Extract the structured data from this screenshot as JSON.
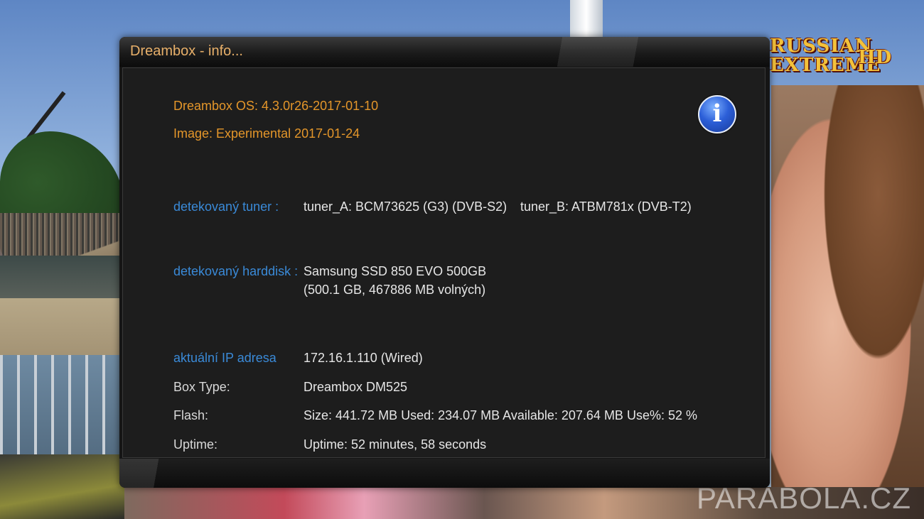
{
  "channel_logo": {
    "line1": "RUSSIAN",
    "line2": "EXTREME",
    "suffix": "HD"
  },
  "watermark": "PARABOLA.CZ",
  "dialog": {
    "title": "Dreambox - info...",
    "os_line": "Dreambox OS: 4.3.0r26-2017-01-10",
    "image_line": "Image: Experimental 2017-01-24",
    "info_icon_glyph": "i",
    "tuner": {
      "label": "detekovaný tuner :",
      "tuner_a": "tuner_A: BCM73625 (G3) (DVB-S2)",
      "tuner_b": "tuner_B: ATBM781x (DVB-T2)"
    },
    "harddisk": {
      "label": "detekovaný harddisk :",
      "line1": "Samsung SSD 850 EVO 500GB",
      "line2": "(500.1 GB, 467886 MB volných)"
    },
    "ip": {
      "label": "aktuální IP adresa",
      "value": "172.16.1.110 (Wired)"
    },
    "box_type": {
      "label": "Box Type:",
      "value": "Dreambox DM525"
    },
    "flash": {
      "label": "Flash:",
      "value": "Size: 441.72 MB Used: 234.07 MB Available: 207.64 MB Use%: 52 %"
    },
    "uptime": {
      "label": "Uptime:",
      "value": "Uptime: 52 minutes, 58 seconds"
    }
  },
  "colors": {
    "title": "#e8b06a",
    "orange_text": "#e4962a",
    "blue_label": "#3a8ad8",
    "value_text": "#e6e6e6",
    "dialog_bg": "#1d1d1d"
  }
}
